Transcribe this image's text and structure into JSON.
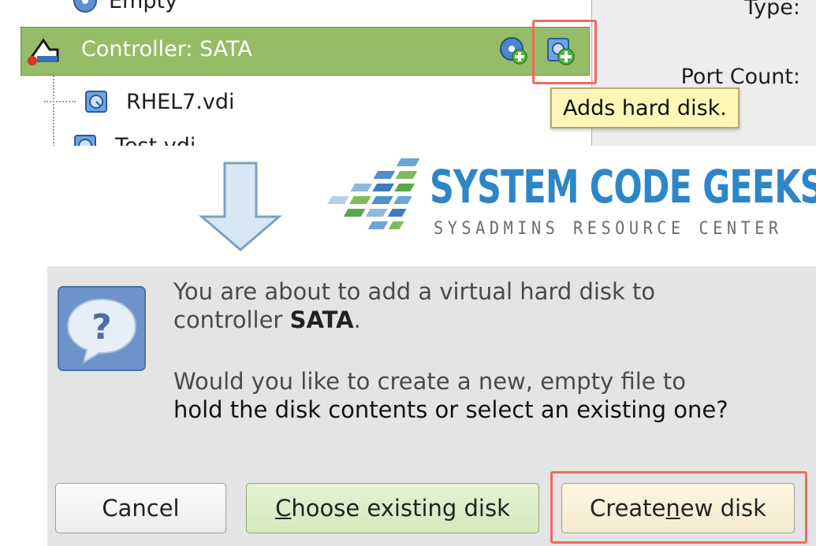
{
  "tree": {
    "empty_label": "Empty",
    "controller_label": "Controller: SATA",
    "disk1_label": "RHEL7.vdi",
    "disk2_label": "Test.vdi"
  },
  "attributes": {
    "type_label": "Type:",
    "port_count_label": "Port Count:"
  },
  "tooltip": {
    "text": "Adds hard disk."
  },
  "logo": {
    "title": "SYSTEM CODE GEEKS",
    "subtitle": "SYSADMINS RESOURCE CENTER"
  },
  "dialog": {
    "line1": "You are about to add a virtual hard disk to",
    "line2_prefix": "controller ",
    "line2_bold": "SATA",
    "line2_suffix": ".",
    "line3": "Would you like to create a new, empty file to",
    "line4": "hold the disk contents or select an existing one?",
    "cancel_label": "Cancel",
    "choose_prefix": "C",
    "choose_rest": "hoose existing disk",
    "create_prefix": "Create ",
    "create_accel": "n",
    "create_rest": "ew disk"
  },
  "colors": {
    "selection": "#95bd67",
    "highlight_outline": "#ef6a5d",
    "tooltip_bg": "#fff6b8",
    "logo_blue": "#2d86c8",
    "dialog_bg": "#e4e4e4"
  }
}
